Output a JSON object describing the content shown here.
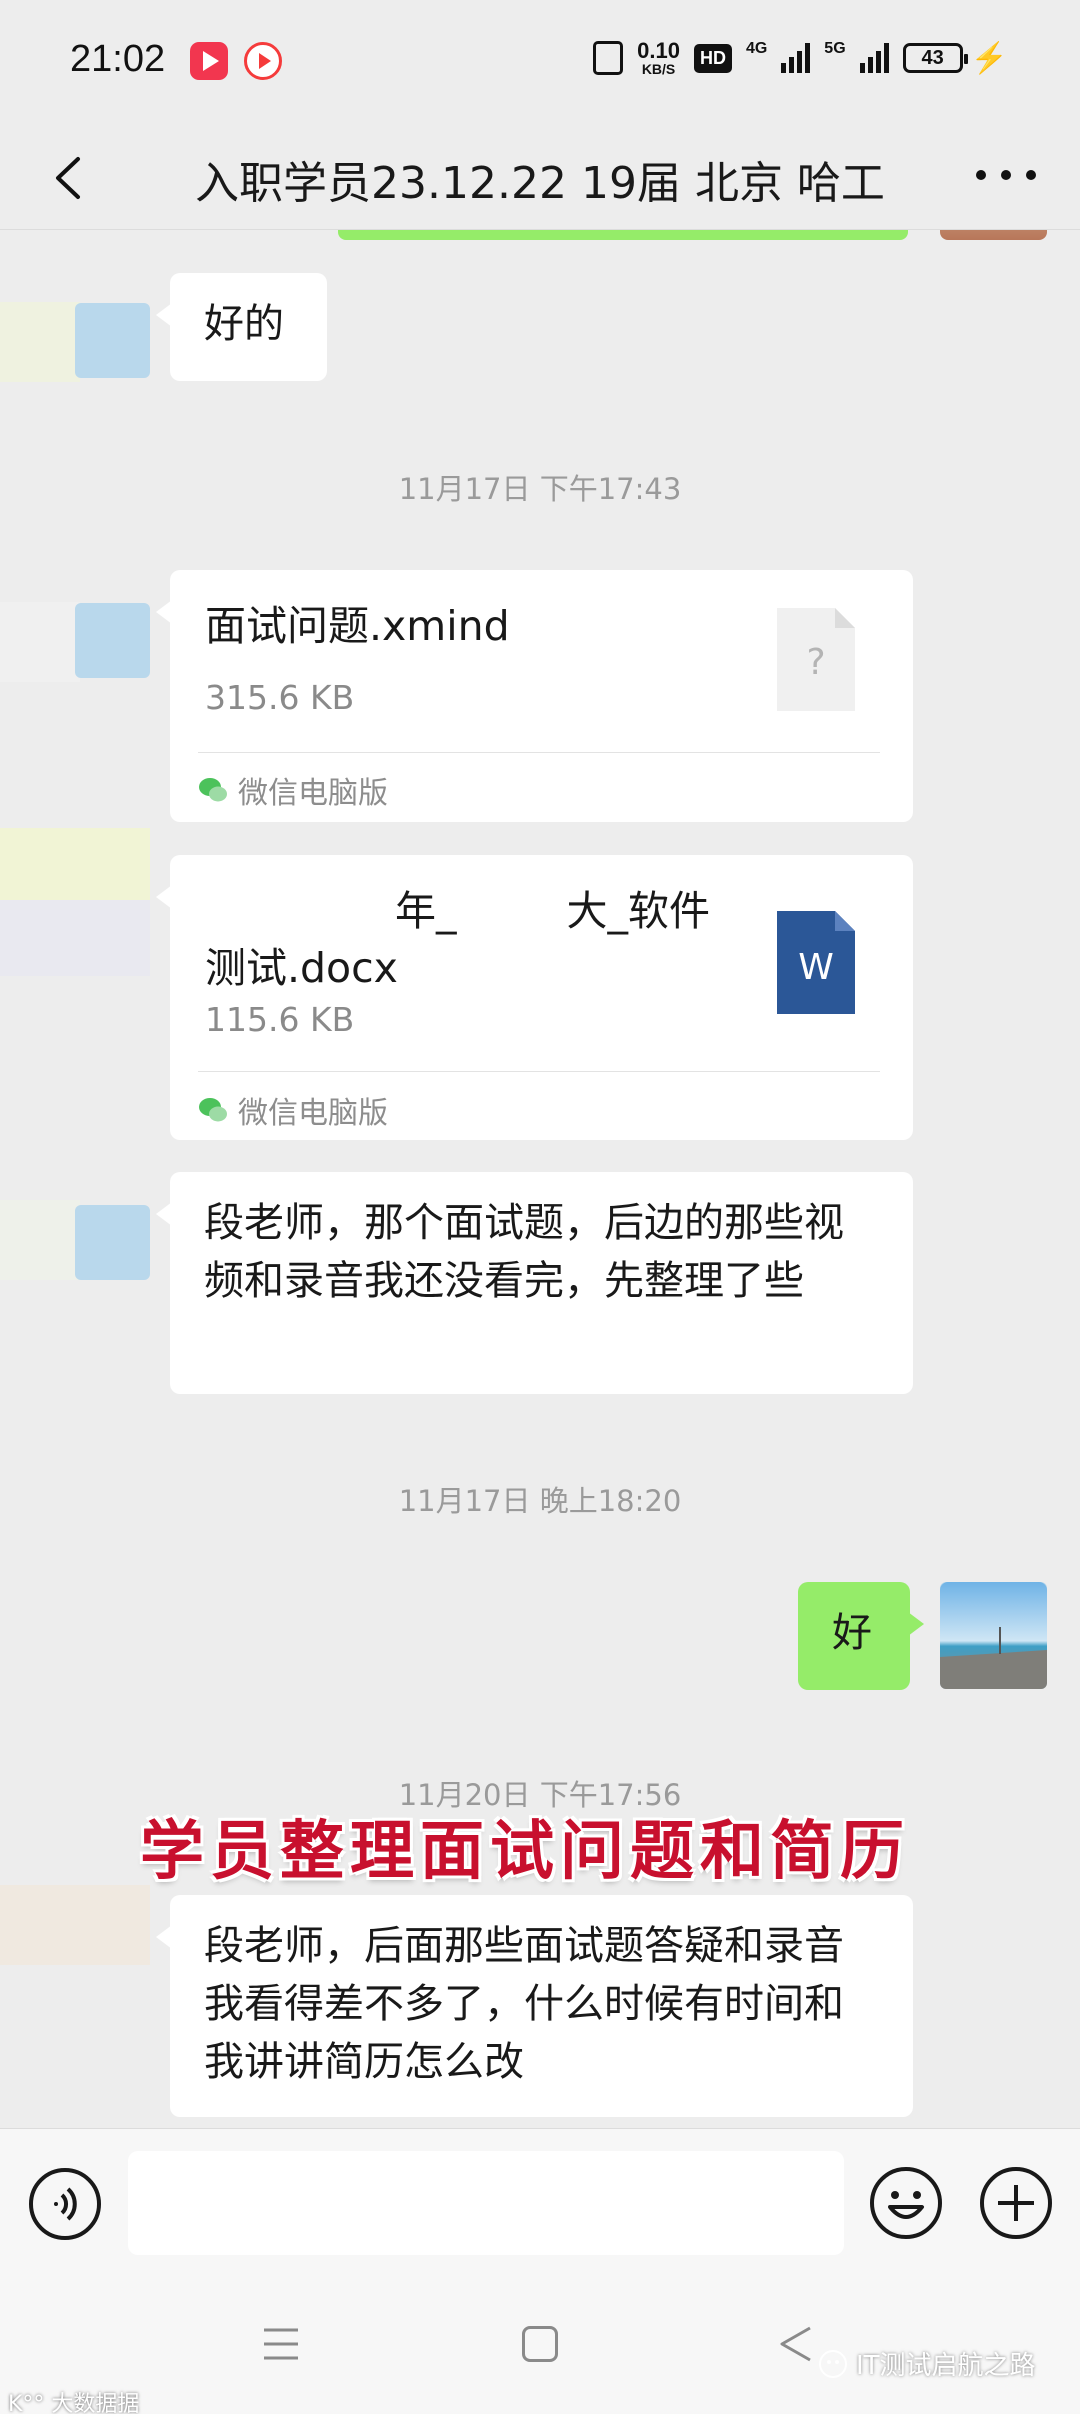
{
  "status_bar": {
    "time": "21:02",
    "net_speed_value": "0.10",
    "net_speed_unit": "KB/S",
    "hd_label": "HD",
    "net_4g": "4G",
    "net_5g": "5G",
    "battery": "43"
  },
  "header": {
    "title": "入职学员23.12.22 19届 北京 哈工"
  },
  "messages": {
    "m1_text": "好的",
    "ts1": "11月17日 下午17:43",
    "file1": {
      "name": "面试问题.xmind",
      "size": "315.6 KB",
      "source": "微信电脑版",
      "icon": "unknown-file-icon",
      "icon_glyph": "?"
    },
    "file2": {
      "name_part1": "年_",
      "name_part2": "大_软件",
      "name_line2": "测试.docx",
      "size": "115.6 KB",
      "source": "微信电脑版",
      "icon": "word-file-icon",
      "icon_glyph": "W"
    },
    "m2_text": "段老师，那个面试题，后边的那些视频和录音我还没看完，先整理了些",
    "ts2": "11月17日 晚上18:20",
    "m3_text": "好",
    "ts3": "11月20日 下午17:56",
    "m4_text": "段老师，后面那些面试题答疑和录音我看得差不多了，什么时候有时间和我讲讲简历怎么改"
  },
  "overlay_caption": "学员整理面试问题和简历",
  "watermarks": {
    "left": "K°° 大数据据",
    "right": "IT测试启航之路"
  },
  "colors": {
    "background": "#ededed",
    "sent_bubble": "#95ec69",
    "received_bubble": "#ffffff",
    "word_blue": "#2b5797",
    "caption_red": "#c8102e"
  }
}
